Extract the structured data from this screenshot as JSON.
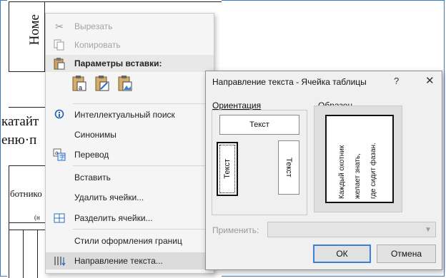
{
  "document": {
    "header_word": "Номе",
    "line_1": "катайт",
    "line_2": "еню·п",
    "line_3": "ботнико",
    "line_4": "(н"
  },
  "context_menu": {
    "items": [
      {
        "label": "Вырезать",
        "icon": "scissors-icon",
        "disabled": true
      },
      {
        "label": "Копировать",
        "icon": "copy-icon",
        "disabled": true
      },
      {
        "label": "Параметры вставки:",
        "icon": "clipboard-icon",
        "header": true
      },
      {
        "label": "Интеллектуальный поиск",
        "icon": "smart-lookup-icon"
      },
      {
        "label": "Синонимы",
        "icon": ""
      },
      {
        "label": "Перевод",
        "icon": "translate-icon"
      },
      {
        "label": "Вставить",
        "icon": ""
      },
      {
        "label": "Удалить ячейки...",
        "icon": ""
      },
      {
        "label": "Разделить ячейки...",
        "icon": "split-cells-icon"
      },
      {
        "label": "Стили оформления границ",
        "icon": ""
      },
      {
        "label": "Направление текста...",
        "icon": "text-direction-icon",
        "highlighted": true
      }
    ]
  },
  "dialog": {
    "title": "Направление текста - Ячейка таблицы",
    "help": "?",
    "close": "✕",
    "orientation_label": "Ориентация",
    "sample_label": "Образец",
    "orientation_options": {
      "horizontal": "Текст",
      "up": "Текст",
      "down": "Текст"
    },
    "sample_text": [
      "Каждый охотник",
      "желает знать,",
      "где сидит фазан."
    ],
    "apply_label": "Применить:",
    "apply_value": "",
    "ok": "ОК",
    "cancel": "Отмена"
  },
  "colors": {
    "frame": "#3a78c8",
    "default_button": "#3c7fd6"
  }
}
